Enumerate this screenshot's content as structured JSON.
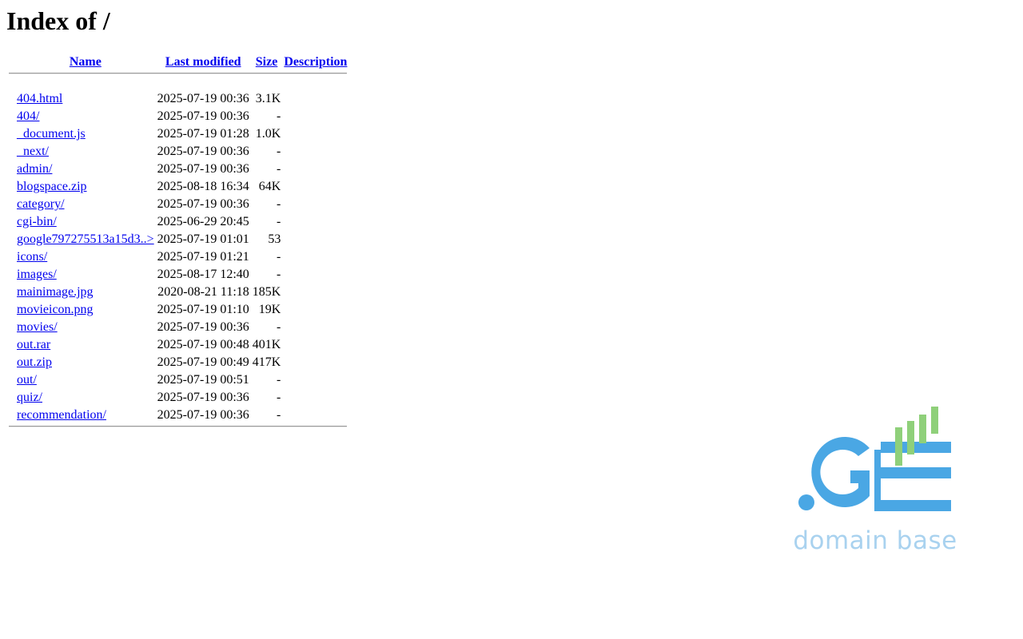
{
  "page": {
    "heading": "Index of /"
  },
  "table": {
    "headers": {
      "name": "Name",
      "last_modified": "Last modified",
      "size": "Size",
      "description": "Description"
    },
    "rows": [
      {
        "name": "404.html",
        "modified": "2025-07-19 00:36",
        "size": "3.1K",
        "description": ""
      },
      {
        "name": "404/",
        "modified": "2025-07-19 00:36",
        "size": "-",
        "description": ""
      },
      {
        "name": "_document.js",
        "modified": "2025-07-19 01:28",
        "size": "1.0K",
        "description": ""
      },
      {
        "name": "_next/",
        "modified": "2025-07-19 00:36",
        "size": "-",
        "description": ""
      },
      {
        "name": "admin/",
        "modified": "2025-07-19 00:36",
        "size": "-",
        "description": ""
      },
      {
        "name": "blogspace.zip",
        "modified": "2025-08-18 16:34",
        "size": "64K",
        "description": ""
      },
      {
        "name": "category/",
        "modified": "2025-07-19 00:36",
        "size": "-",
        "description": ""
      },
      {
        "name": "cgi-bin/",
        "modified": "2025-06-29 20:45",
        "size": "-",
        "description": ""
      },
      {
        "name": "google797275513a15d3..>",
        "modified": "2025-07-19 01:01",
        "size": "53",
        "description": ""
      },
      {
        "name": "icons/",
        "modified": "2025-07-19 01:21",
        "size": "-",
        "description": ""
      },
      {
        "name": "images/",
        "modified": "2025-08-17 12:40",
        "size": "-",
        "description": ""
      },
      {
        "name": "mainimage.jpg",
        "modified": "2020-08-21 11:18",
        "size": "185K",
        "description": ""
      },
      {
        "name": "movieicon.png",
        "modified": "2025-07-19 01:10",
        "size": "19K",
        "description": ""
      },
      {
        "name": "movies/",
        "modified": "2025-07-19 00:36",
        "size": "-",
        "description": ""
      },
      {
        "name": "out.rar",
        "modified": "2025-07-19 00:48",
        "size": "401K",
        "description": ""
      },
      {
        "name": "out.zip",
        "modified": "2025-07-19 00:49",
        "size": "417K",
        "description": ""
      },
      {
        "name": "out/",
        "modified": "2025-07-19 00:51",
        "size": "-",
        "description": ""
      },
      {
        "name": "quiz/",
        "modified": "2025-07-19 00:36",
        "size": "-",
        "description": ""
      },
      {
        "name": "recommendation/",
        "modified": "2025-07-19 00:36",
        "size": "-",
        "description": ""
      }
    ]
  },
  "logo": {
    "caption": "domain base",
    "icon": "ge-domain-logo",
    "colors": {
      "blue": "#4aa7e4",
      "green": "#8fd07a",
      "caption": "#a9d2ef"
    }
  },
  "colors": {
    "link": "#0000ee",
    "rule": "#999999"
  }
}
